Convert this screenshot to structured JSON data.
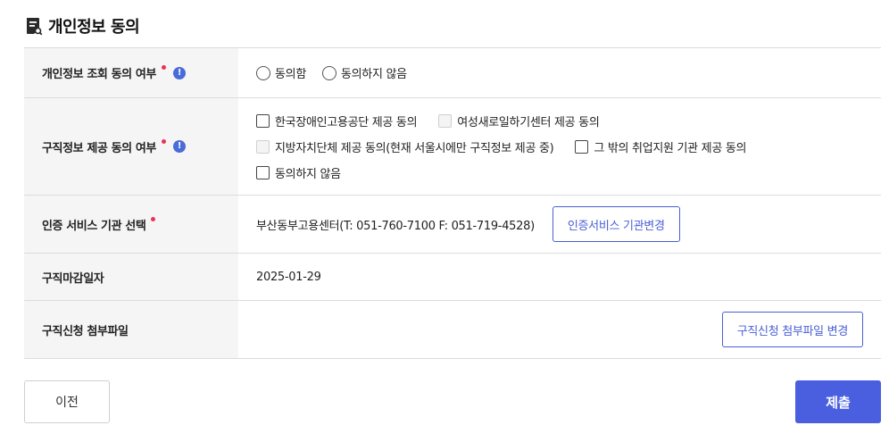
{
  "section": {
    "title": "개인정보 동의",
    "icon": "document-search-icon"
  },
  "rows": {
    "inquiry": {
      "label": "개인정보 조회 동의 여부",
      "options": [
        "동의함",
        "동의하지 않음"
      ]
    },
    "provide": {
      "label": "구직정보 제공 동의 여부",
      "options": [
        "한국장애인고용공단 제공 동의",
        "여성새로일하기센터 제공 동의",
        "지방자치단체 제공 동의(현재 서울시에만 구직정보 제공 중)",
        "그 밖의 취업지원 기관 제공 동의",
        "동의하지 않음"
      ]
    },
    "certification": {
      "label": "인증 서비스 기관 선택",
      "value": "부산동부고용센터(T: 051-760-7100 F: 051-719-4528)",
      "button": "인증서비스 기관변경"
    },
    "deadline": {
      "label": "구직마감일자",
      "value": "2025-01-29"
    },
    "attachment": {
      "label": "구직신청 첨부파일",
      "button": "구직신청 첨부파일 변경"
    }
  },
  "footer": {
    "prev": "이전",
    "submit": "제출"
  },
  "info_icon_glyph": "!",
  "colors": {
    "accent": "#4a5fe0",
    "required": "#e8335b",
    "header_bg": "#f5f5f5"
  }
}
